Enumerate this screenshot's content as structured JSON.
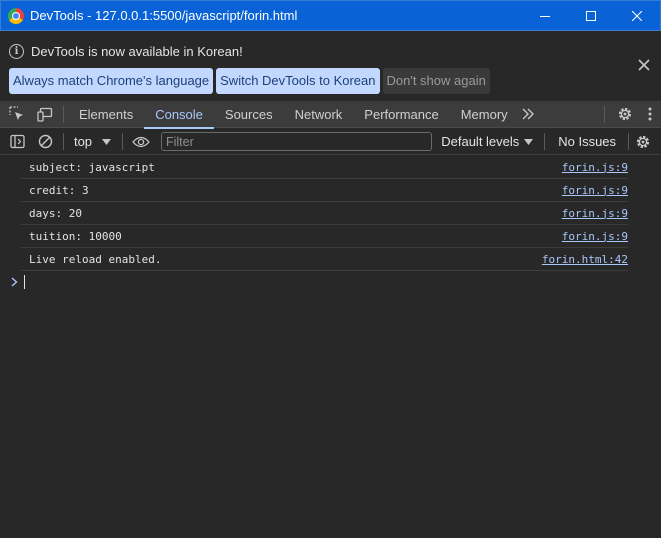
{
  "window": {
    "title": "DevTools - 127.0.0.1:5500/javascript/forin.html"
  },
  "infobar": {
    "message": "DevTools is now available in Korean!",
    "buttons": [
      "Always match Chrome's language",
      "Switch DevTools to Korean",
      "Don't show again"
    ]
  },
  "tabs": [
    {
      "label": "Elements",
      "active": false
    },
    {
      "label": "Console",
      "active": true
    },
    {
      "label": "Sources",
      "active": false
    },
    {
      "label": "Network",
      "active": false
    },
    {
      "label": "Performance",
      "active": false
    },
    {
      "label": "Memory",
      "active": false
    }
  ],
  "console_toolbar": {
    "context": "top",
    "filter_placeholder": "Filter",
    "filter_value": "",
    "levels": "Default levels",
    "issues": "No Issues"
  },
  "messages": [
    {
      "text": "subject: javascript",
      "source": "forin.js:9"
    },
    {
      "text": "credit: 3",
      "source": "forin.js:9"
    },
    {
      "text": "days: 20",
      "source": "forin.js:9"
    },
    {
      "text": "tuition: 10000",
      "source": "forin.js:9"
    },
    {
      "text": "Live reload enabled.",
      "source": "forin.html:42"
    }
  ],
  "colors": {
    "titlebar": "#0a63d6",
    "accent": "#a8c7fa",
    "background": "#282828",
    "toolbar": "#3c3c3c"
  }
}
